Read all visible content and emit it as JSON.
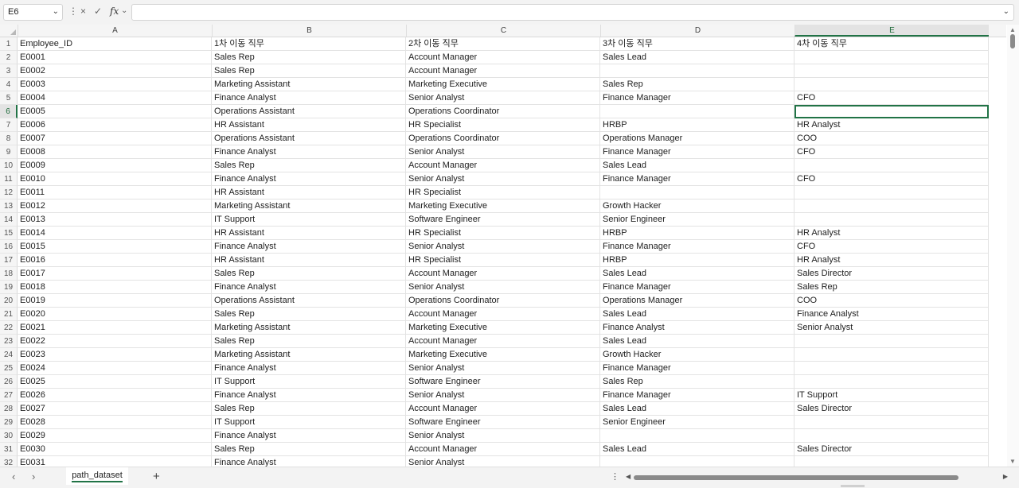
{
  "formula_bar": {
    "name_box": "E6",
    "more_icon": "vertical-dots",
    "cancel_icon": "×",
    "enter_icon": "✓",
    "fx_label": "fx",
    "formula": ""
  },
  "columns": [
    "A",
    "B",
    "C",
    "D",
    "E"
  ],
  "selected": {
    "col": "E",
    "row": 6
  },
  "rows": [
    [
      "Employee_ID",
      "1차 이동 직무",
      "2차 이동 직무",
      "3차 이동 직무",
      "4차 이동 직무"
    ],
    [
      "E0001",
      "Sales Rep",
      "Account Manager",
      "Sales Lead",
      ""
    ],
    [
      "E0002",
      "Sales Rep",
      "Account Manager",
      "",
      ""
    ],
    [
      "E0003",
      "Marketing Assistant",
      "Marketing Executive",
      "Sales Rep",
      ""
    ],
    [
      "E0004",
      "Finance Analyst",
      "Senior Analyst",
      "Finance Manager",
      "CFO"
    ],
    [
      "E0005",
      "Operations Assistant",
      "Operations Coordinator",
      "",
      ""
    ],
    [
      "E0006",
      "HR Assistant",
      "HR Specialist",
      "HRBP",
      "HR Analyst"
    ],
    [
      "E0007",
      "Operations Assistant",
      "Operations Coordinator",
      "Operations Manager",
      "COO"
    ],
    [
      "E0008",
      "Finance Analyst",
      "Senior Analyst",
      "Finance Manager",
      "CFO"
    ],
    [
      "E0009",
      "Sales Rep",
      "Account Manager",
      "Sales Lead",
      ""
    ],
    [
      "E0010",
      "Finance Analyst",
      "Senior Analyst",
      "Finance Manager",
      "CFO"
    ],
    [
      "E0011",
      "HR Assistant",
      "HR Specialist",
      "",
      ""
    ],
    [
      "E0012",
      "Marketing Assistant",
      "Marketing Executive",
      "Growth Hacker",
      ""
    ],
    [
      "E0013",
      "IT Support",
      "Software Engineer",
      "Senior Engineer",
      ""
    ],
    [
      "E0014",
      "HR Assistant",
      "HR Specialist",
      "HRBP",
      "HR Analyst"
    ],
    [
      "E0015",
      "Finance Analyst",
      "Senior Analyst",
      "Finance Manager",
      "CFO"
    ],
    [
      "E0016",
      "HR Assistant",
      "HR Specialist",
      "HRBP",
      "HR Analyst"
    ],
    [
      "E0017",
      "Sales Rep",
      "Account Manager",
      "Sales Lead",
      "Sales Director"
    ],
    [
      "E0018",
      "Finance Analyst",
      "Senior Analyst",
      "Finance Manager",
      "Sales Rep"
    ],
    [
      "E0019",
      "Operations Assistant",
      "Operations Coordinator",
      "Operations Manager",
      "COO"
    ],
    [
      "E0020",
      "Sales Rep",
      "Account Manager",
      "Sales Lead",
      "Finance Analyst"
    ],
    [
      "E0021",
      "Marketing Assistant",
      "Marketing Executive",
      "Finance Analyst",
      "Senior Analyst"
    ],
    [
      "E0022",
      "Sales Rep",
      "Account Manager",
      "Sales Lead",
      ""
    ],
    [
      "E0023",
      "Marketing Assistant",
      "Marketing Executive",
      "Growth Hacker",
      ""
    ],
    [
      "E0024",
      "Finance Analyst",
      "Senior Analyst",
      "Finance Manager",
      ""
    ],
    [
      "E0025",
      "IT Support",
      "Software Engineer",
      "Sales Rep",
      ""
    ],
    [
      "E0026",
      "Finance Analyst",
      "Senior Analyst",
      "Finance Manager",
      "IT Support"
    ],
    [
      "E0027",
      "Sales Rep",
      "Account Manager",
      "Sales Lead",
      "Sales Director"
    ],
    [
      "E0028",
      "IT Support",
      "Software Engineer",
      "Senior Engineer",
      ""
    ],
    [
      "E0029",
      "Finance Analyst",
      "Senior Analyst",
      "",
      ""
    ],
    [
      "E0030",
      "Sales Rep",
      "Account Manager",
      "Sales Lead",
      "Sales Director"
    ],
    [
      "E0031",
      "Finance Analyst",
      "Senior Analyst",
      "",
      ""
    ]
  ],
  "sheet_tabs": [
    {
      "label": "path_dataset",
      "active": true
    }
  ],
  "tabbar": {
    "add_label": "+",
    "more_label": "⋮",
    "prev_label": "‹",
    "next_label": "›"
  }
}
